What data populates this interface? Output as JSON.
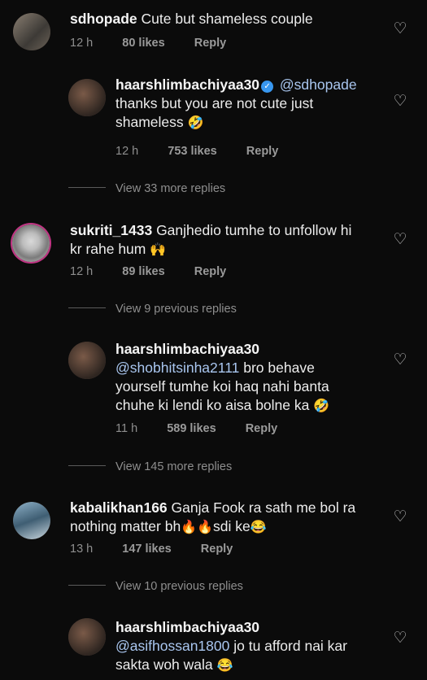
{
  "comments": [
    {
      "username": "sdhopade",
      "text": "Cute but shameless couple",
      "time": "12 h",
      "likes": "80 likes",
      "reply": "Reply"
    },
    {
      "username": "haarshlimbachiyaa30",
      "mention": "@sdhopade",
      "text_line1": "thanks but you are not cute just",
      "text_line2": "shameless",
      "emoji": "🤣",
      "time": "12 h",
      "likes": "753 likes",
      "reply": "Reply"
    },
    {
      "username": "sukriti_1433",
      "text_line1": "Ganjhedio tumhe to unfollow hi",
      "text_line2": "kr rahe hum",
      "emoji": "🙌",
      "time": "12 h",
      "likes": "89 likes",
      "reply": "Reply"
    },
    {
      "username": "haarshlimbachiyaa30",
      "mention": "@shobhitsinha2111",
      "text_line1": " bro behave",
      "text_line2": "yourself tumhe koi haq nahi banta",
      "text_line3": "chuhe ki lendi ko aisa bolne ka",
      "emoji": "🤣",
      "time": "11 h",
      "likes": "589 likes",
      "reply": "Reply"
    },
    {
      "username": "kabalikhan166",
      "text_line1": "Ganja Fook ra sath me bol ra",
      "text_line2a": "nothing matter bh",
      "fire1": "🔥",
      "fire2": "🔥",
      "text_line2b": "sdi ke",
      "emoji": "😂",
      "time": "13 h",
      "likes": "147 likes",
      "reply": "Reply"
    },
    {
      "username": "haarshlimbachiyaa30",
      "mention": "@asifhossan1800",
      "text_line1": " jo tu afford nai kar",
      "text_line2": "sakta woh wala",
      "emoji": "😂"
    }
  ],
  "more_replies": [
    "View 33 more replies",
    "View 9 previous replies",
    "View 145 more replies",
    "View 10 previous replies"
  ],
  "icons": {
    "heart": "♡",
    "verified": "✓"
  },
  "colors": {
    "background": "#0b0b0b",
    "mention": "#a9c6ef",
    "verified": "#3897f0",
    "story_ring": "#c13584"
  }
}
